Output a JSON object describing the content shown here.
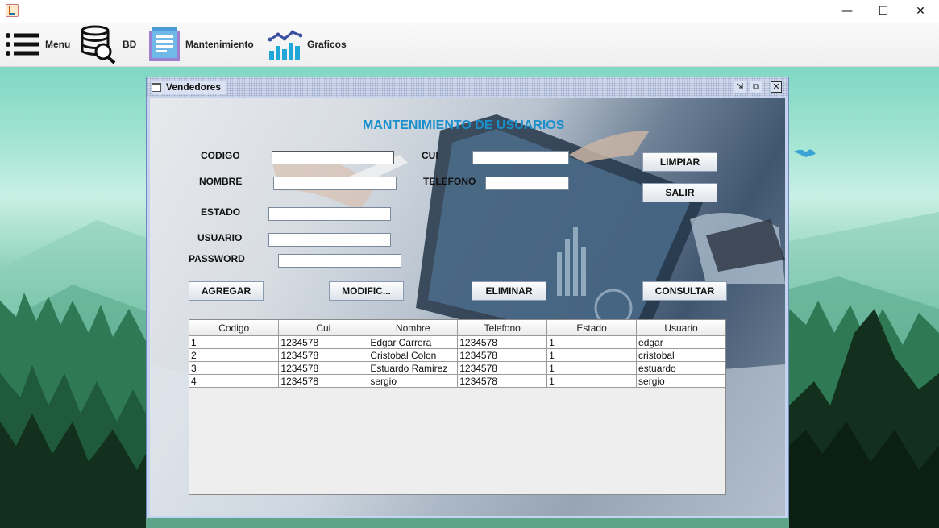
{
  "window": {
    "minimize_glyph": "—",
    "maximize_glyph": "☐",
    "close_glyph": "✕"
  },
  "menubar": {
    "items": [
      {
        "label": "Menu",
        "icon": "hamburger-menu-icon"
      },
      {
        "label": "BD",
        "icon": "database-search-icon"
      },
      {
        "label": "Mantenimiento",
        "icon": "document-list-icon"
      },
      {
        "label": "Graficos",
        "icon": "bar-chart-icon"
      }
    ]
  },
  "internal_frame": {
    "title": "Vendedores",
    "controls": [
      "minimize-icon",
      "maximize-icon",
      "close-icon"
    ]
  },
  "form": {
    "heading": "MANTENIMIENTO DE USUARIOS",
    "labels": {
      "codigo": "CODIGO",
      "cui": "CUI",
      "nombre": "NOMBRE",
      "telefono": "TELEFONO",
      "estado": "ESTADO",
      "usuario": "USUARIO",
      "password": "PASSWORD"
    },
    "values": {
      "codigo": "",
      "cui": "",
      "nombre": "",
      "telefono": "",
      "estado": "",
      "usuario": "",
      "password": ""
    },
    "buttons": {
      "limpiar": "LIMPIAR",
      "salir": "SALIR",
      "agregar": "AGREGAR",
      "modificar": "MODIFIC...",
      "eliminar": "ELIMINAR",
      "consultar": "CONSULTAR"
    }
  },
  "table": {
    "columns": [
      "Codigo",
      "Cui",
      "Nombre",
      "Telefono",
      "Estado",
      "Usuario"
    ],
    "rows": [
      [
        "1",
        "1234578",
        "Edgar Carrera",
        "1234578",
        "1",
        "edgar"
      ],
      [
        "2",
        "1234578",
        "Cristobal Colon",
        "1234578",
        "1",
        "cristobal"
      ],
      [
        "3",
        "1234578",
        "Estuardo Ramirez",
        "1234578",
        "1",
        "estuardo"
      ],
      [
        "4",
        "1234578",
        "sergio",
        "1234578",
        "1",
        "sergio"
      ]
    ]
  },
  "colors": {
    "heading": "#1a8fcc",
    "frame_border": "#7088c0"
  }
}
